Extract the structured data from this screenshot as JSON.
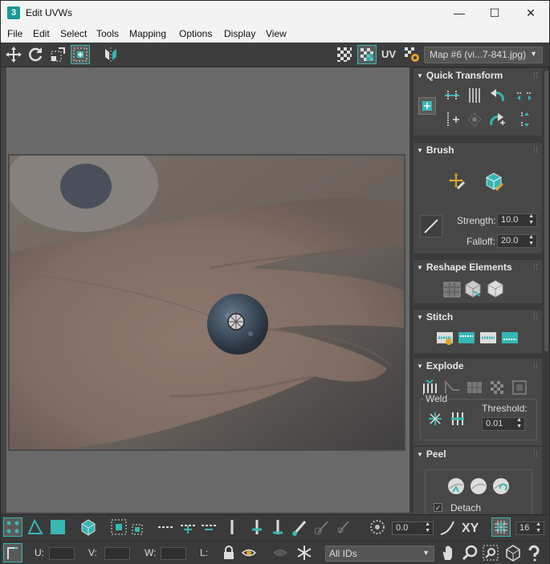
{
  "window": {
    "title": "Edit UVWs",
    "app_icon": "3",
    "minimize": "—",
    "maximize": "☐",
    "close": "✕"
  },
  "menu": [
    "File",
    "Edit",
    "Select",
    "Tools",
    "Mapping",
    "Options",
    "Display",
    "View"
  ],
  "toolbar": {
    "uv_label": "UV",
    "map_select": "Map #6 (vi...7-841.jpg)"
  },
  "panel": {
    "quick_transform": "Quick Transform",
    "brush": "Brush",
    "brush_strength_label": "Strength:",
    "brush_strength": "10.0",
    "brush_falloff_label": "Falloff:",
    "brush_falloff": "20.0",
    "reshape": "Reshape Elements",
    "stitch": "Stitch",
    "explode": "Explode",
    "weld": "Weld",
    "threshold_label": "Threshold:",
    "threshold": "0.01",
    "peel": "Peel",
    "detach": "Detach"
  },
  "bottom": {
    "angle": "0.0",
    "xy": "XY",
    "grid_value": "16",
    "u_label": "U:",
    "v_label": "V:",
    "w_label": "W:",
    "l_label": "L:",
    "ids": "All IDs"
  },
  "colors": {
    "accent": "#36b7b4",
    "panel": "#474747",
    "viewport": "#6d6d6d"
  }
}
